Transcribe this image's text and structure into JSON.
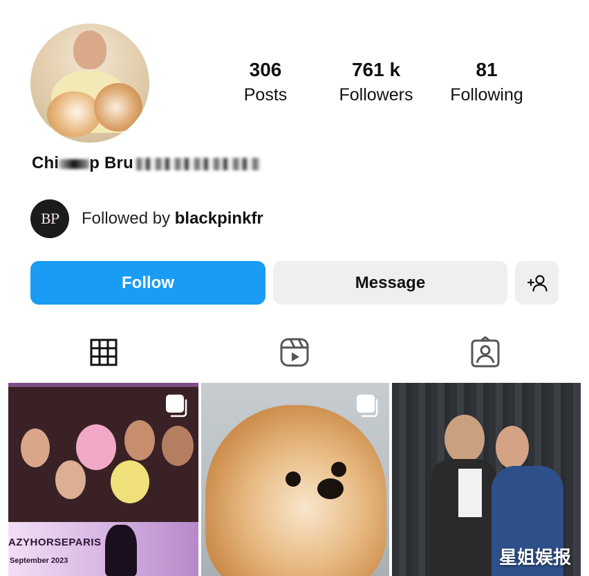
{
  "profile": {
    "name_visible": "Chi",
    "name_visible_2": "p Bru"
  },
  "stats": [
    {
      "value": "306",
      "label": "Posts"
    },
    {
      "value": "761 k",
      "label": "Followers"
    },
    {
      "value": "81",
      "label": "Following"
    }
  ],
  "followed_by": {
    "avatar_text": "BP",
    "prefix": "Followed by",
    "username": "blackpinkfr"
  },
  "actions": {
    "follow_label": "Follow",
    "message_label": "Message",
    "add_user_icon": "person-add-icon"
  },
  "tabs": [
    {
      "icon": "grid-icon"
    },
    {
      "icon": "reels-icon"
    },
    {
      "icon": "tagged-icon"
    }
  ],
  "posts": [
    {
      "caption": "AZYHORSEPARIS",
      "subcaption": "September 2023"
    },
    {},
    {}
  ],
  "watermark": "星姐娱报",
  "colors": {
    "follow_button": "#1a9cf4",
    "secondary_button": "#efefef"
  }
}
